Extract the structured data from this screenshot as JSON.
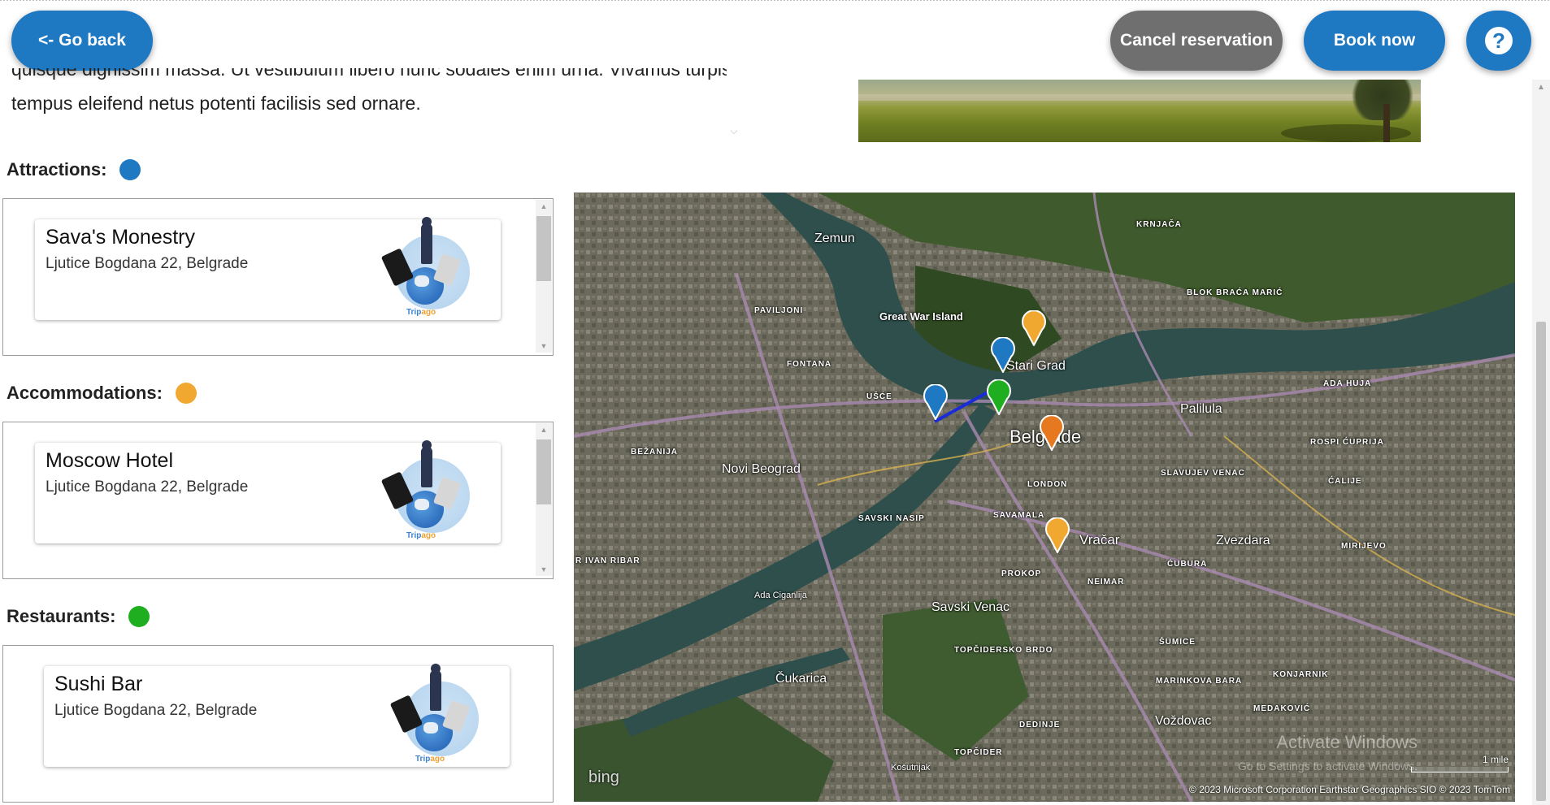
{
  "toolbar": {
    "go_back": "<- Go back",
    "cancel_reservation": "Cancel reservation",
    "book_now": "Book now",
    "help": "?"
  },
  "description": {
    "line1": "quisque dignissim massa. Ut vestibulum libero nunc sodales enim urna. Vivamus turpis",
    "line2": "tempus eleifend netus potenti facilisis sed ornare."
  },
  "sections": {
    "attractions": {
      "title": "Attractions:",
      "color": "#1e78c2",
      "items": [
        {
          "name": "Sava's Monestry",
          "address": "Ljutice Bogdana 22, Belgrade"
        }
      ]
    },
    "accommodations": {
      "title": "Accommodations:",
      "color": "#f0a830",
      "items": [
        {
          "name": "Moscow Hotel",
          "address": "Ljutice Bogdana 22, Belgrade"
        }
      ]
    },
    "restaurants": {
      "title": "Restaurants:",
      "color": "#1fae1f",
      "items": [
        {
          "name": "Sushi Bar",
          "address": "Ljutice Bogdana 22, Belgrade"
        }
      ]
    }
  },
  "logo": {
    "brand_a": "Trip",
    "brand_b": "ago"
  },
  "map": {
    "labels": {
      "zemun": "Zemun",
      "great_war_island": "Great War Island",
      "stari_grad": "Stari Grad",
      "belgrade": "Belgrade",
      "novi_beograd": "Novi Beograd",
      "palilula": "Palilula",
      "vracar": "Vračar",
      "zvezdara": "Zvezdara",
      "savski_venac": "Savski Venac",
      "cukarica": "Čukarica",
      "vozdovac": "Voždovac",
      "ada_ciganlija": "Ada Ciganlija",
      "krnjaca": "KRNJAČA",
      "fontana": "FONTANA",
      "pavlovici": "PAVILJONI",
      "usce": "UŠĆE",
      "bezanija": "BEŽANIJA",
      "london": "LONDON",
      "savamala": "SAVAMALA",
      "slavija": "SLAVUJEV VENAC",
      "neimar": "NEIMAR",
      "cubura": "ĆUBURA",
      "sumice": "ŠUMICE",
      "dedinje": "DEDINJE",
      "topcidersko": "TOPČIDERSKO BRDO",
      "kosutnjak": "Košutnjak",
      "konjarnik": "KONJARNIK",
      "medakovic": "MEDAKOVIĆ",
      "mirijevo": "MIRIJEVO",
      "calije": "ĆALIJE",
      "ada_huja": "ADA HUJA",
      "rospi_cuprija": "ROSPI ĆUPRIJA",
      "blok_braca": "BLOK BRAĆA MARIĆ",
      "topcider": "TOPČIDER",
      "marinkova": "MARINKOVA BARA",
      "prokop": "PROKOP",
      "savski_nasip": "SAVSKI NASIP",
      "ivan_ribar": "R IVAN RIBAR"
    },
    "bing": "bing",
    "scale": "1 mile",
    "copyright": "© 2023 Microsoft Corporation   Earthstar Geographics  SIO   © 2023 TomTom",
    "watermark": "Activate Windows",
    "watermark_sub": "Go to Settings to activate Windows."
  }
}
